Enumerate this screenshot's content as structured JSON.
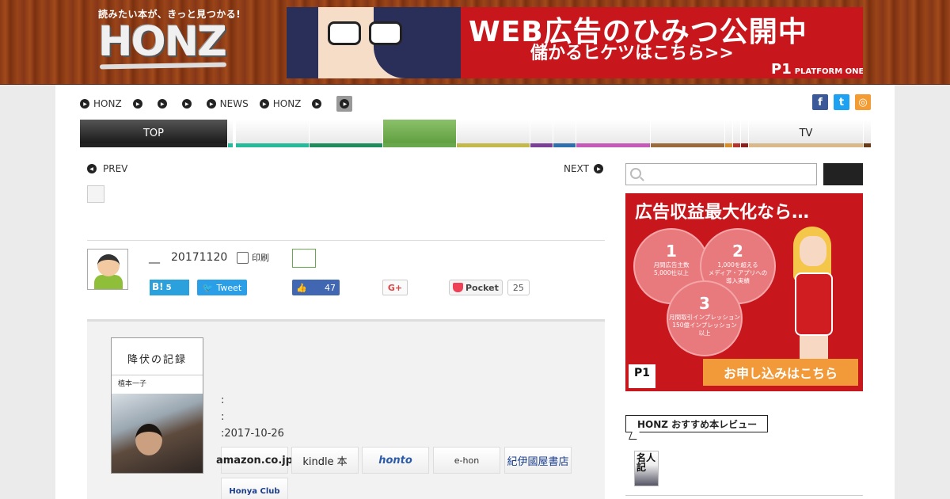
{
  "header": {
    "logo_tagline": "読みたい本が、きっと見つかる!",
    "logo_text": "HONZ",
    "ad": {
      "title": "WEB広告のひみつ公開中",
      "subtitle": "儲かるヒケツはこちら>>",
      "brand_mark": "P1",
      "brand_name": "PLATFORM ONE"
    }
  },
  "breadcrumb": [
    {
      "label": "HONZ"
    },
    {
      "label": ""
    },
    {
      "label": ""
    },
    {
      "label": ""
    },
    {
      "label": "NEWS"
    },
    {
      "label": "HONZ"
    },
    {
      "label": ""
    },
    {
      "label": ""
    }
  ],
  "social_top": {
    "facebook_glyph": "f",
    "twitter_glyph": "t",
    "rss_glyph": "◎",
    "colors": {
      "facebook": "#3b5998",
      "twitter": "#1da1f2",
      "rss": "#f39c34"
    }
  },
  "categories": [
    {
      "label": "TOP",
      "color": "#222222",
      "active": true
    },
    {
      "label": "",
      "color": "#26b99a"
    },
    {
      "label": "",
      "color": "#1e8c5c"
    },
    {
      "label": "",
      "color": "#6aa84f",
      "highlight": true
    },
    {
      "label": "",
      "color": "#c2b94a"
    },
    {
      "label": "",
      "color": "#7b3f98"
    },
    {
      "label": "",
      "color": "#2f6fb0"
    },
    {
      "label": "",
      "color": "#c45bb8"
    },
    {
      "label": "",
      "color": "#9b6a3a"
    },
    {
      "label": "",
      "color": "#d98c2a"
    },
    {
      "label": "",
      "color": "#b5352d"
    },
    {
      "label": "",
      "color": "#8b1e1e"
    },
    {
      "label": "TV",
      "color": "#d9b98a"
    },
    {
      "label": "",
      "color": "#6b3a16"
    }
  ],
  "post_nav": {
    "prev": "PREV",
    "next": "NEXT"
  },
  "article": {
    "author_dash": "__",
    "date": "20171120",
    "print_label": "印刷"
  },
  "share": {
    "hatena_label": "B!",
    "hatena_count": "5",
    "tweet_label": "Tweet",
    "like_count": "47",
    "gplus_label": "G+",
    "pocket_label": "Pocket",
    "pocket_count": "25"
  },
  "book": {
    "cover_title": "降伏の記録",
    "cover_author": "植本一子",
    "line1": ":",
    "line2": ":",
    "line3": ":2017-10-26",
    "stores": [
      "amazon.co.jp",
      "kindle 本",
      "honto",
      "e-hon",
      "紀伊國屋書店",
      "Honya Club"
    ]
  },
  "sidebar": {
    "search_placeholder": "",
    "ad": {
      "title": "広告収益最大化なら…",
      "circles": [
        {
          "num": "1",
          "text": "月間広告主数\n5,000社以上"
        },
        {
          "num": "2",
          "text": "1,000を超える\nメディア・アプリへの\n導入実績"
        },
        {
          "num": "3",
          "text": "月間取引インプレッション\n150億インプレッション\n以上"
        }
      ],
      "cta": "お申し込みはこちら",
      "logo": "P1"
    },
    "recommend_label": "HONZ おすすめ本レビュー",
    "recommend_book_title": "名人 記"
  }
}
